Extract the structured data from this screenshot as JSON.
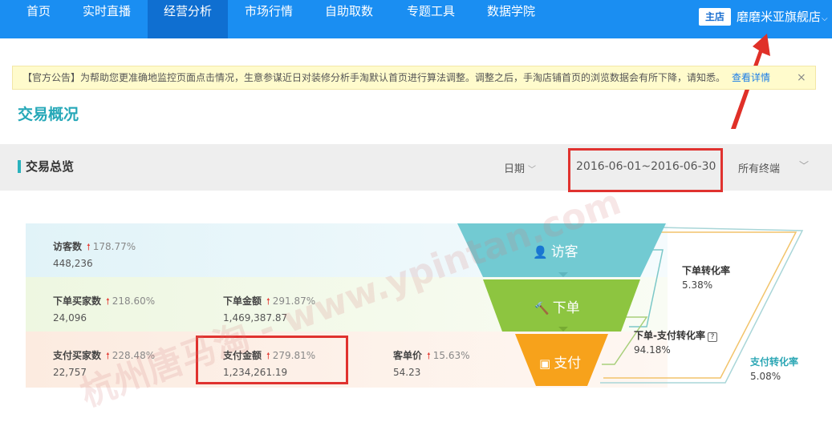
{
  "nav": {
    "items": [
      "首页",
      "实时直播",
      "经营分析",
      "市场行情",
      "自助取数",
      "专题工具",
      "数据学院"
    ],
    "active_index": 2,
    "shop_badge": "主店",
    "shop_name": "磨磨米亚旗舰店"
  },
  "notice": {
    "text": "【官方公告】为帮助您更准确地监控页面点击情况，生意参谋近日对装修分析手淘默认首页进行算法调整。调整之后，手淘店铺首页的浏览数据会有所下降，请知悉。",
    "link": "查看详情",
    "close": "×"
  },
  "page_title": "交易概况",
  "section": {
    "title": "交易总览",
    "date_label": "日期",
    "date_range": "2016-06-01~2016-06-30",
    "terminal": "所有终端"
  },
  "metrics": {
    "visitors": {
      "label": "访客数",
      "rate": "178.77%",
      "value": "448,236"
    },
    "order_buyers": {
      "label": "下单买家数",
      "rate": "218.60%",
      "value": "24,096"
    },
    "order_amount": {
      "label": "下单金额",
      "rate": "291.87%",
      "value": "1,469,387.87"
    },
    "pay_buyers": {
      "label": "支付买家数",
      "rate": "228.48%",
      "value": "22,757"
    },
    "pay_amount": {
      "label": "支付金额",
      "rate": "279.81%",
      "value": "1,234,261.19"
    },
    "unit_price": {
      "label": "客单价",
      "rate": "15.63%",
      "value": "54.23"
    }
  },
  "funnel": {
    "stage_visit": "访客",
    "stage_order": "下单",
    "stage_pay": "支付"
  },
  "rates": {
    "order_conv": {
      "label": "下单转化率",
      "value": "5.38%"
    },
    "order_pay_conv": {
      "label": "下单-支付转化率",
      "value": "94.18%",
      "help": "?"
    },
    "pay_conv": {
      "label": "支付转化率",
      "value": "5.08%"
    }
  },
  "watermark": "杭州唐马淘 - www.ypintan.com",
  "colors": {
    "nav": "#1a8ef2",
    "teal": "#6ccbd3",
    "green": "#8cc63f",
    "orange": "#f7a21b",
    "highlight": "#e0322f"
  }
}
